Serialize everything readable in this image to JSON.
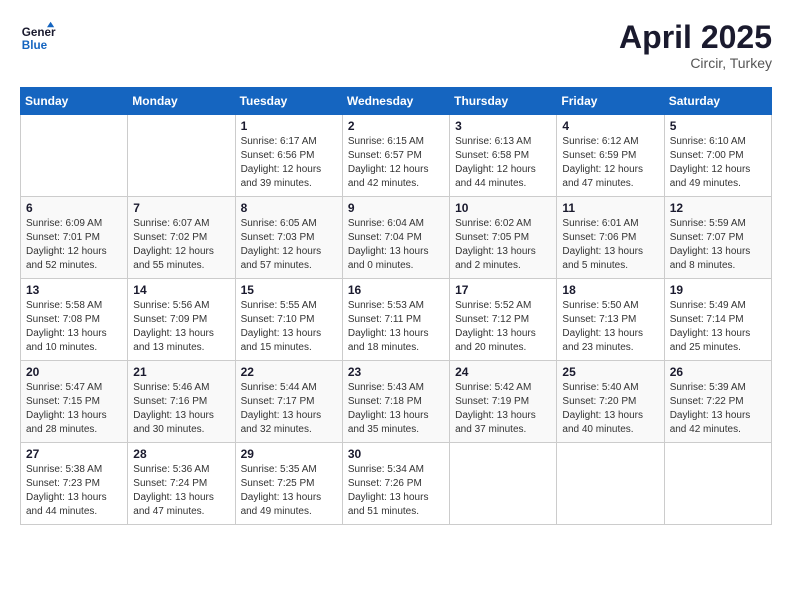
{
  "header": {
    "logo_line1": "General",
    "logo_line2": "Blue",
    "month_year": "April 2025",
    "location": "Circir, Turkey"
  },
  "weekdays": [
    "Sunday",
    "Monday",
    "Tuesday",
    "Wednesday",
    "Thursday",
    "Friday",
    "Saturday"
  ],
  "weeks": [
    [
      {
        "day": "",
        "detail": ""
      },
      {
        "day": "",
        "detail": ""
      },
      {
        "day": "1",
        "detail": "Sunrise: 6:17 AM\nSunset: 6:56 PM\nDaylight: 12 hours\nand 39 minutes."
      },
      {
        "day": "2",
        "detail": "Sunrise: 6:15 AM\nSunset: 6:57 PM\nDaylight: 12 hours\nand 42 minutes."
      },
      {
        "day": "3",
        "detail": "Sunrise: 6:13 AM\nSunset: 6:58 PM\nDaylight: 12 hours\nand 44 minutes."
      },
      {
        "day": "4",
        "detail": "Sunrise: 6:12 AM\nSunset: 6:59 PM\nDaylight: 12 hours\nand 47 minutes."
      },
      {
        "day": "5",
        "detail": "Sunrise: 6:10 AM\nSunset: 7:00 PM\nDaylight: 12 hours\nand 49 minutes."
      }
    ],
    [
      {
        "day": "6",
        "detail": "Sunrise: 6:09 AM\nSunset: 7:01 PM\nDaylight: 12 hours\nand 52 minutes."
      },
      {
        "day": "7",
        "detail": "Sunrise: 6:07 AM\nSunset: 7:02 PM\nDaylight: 12 hours\nand 55 minutes."
      },
      {
        "day": "8",
        "detail": "Sunrise: 6:05 AM\nSunset: 7:03 PM\nDaylight: 12 hours\nand 57 minutes."
      },
      {
        "day": "9",
        "detail": "Sunrise: 6:04 AM\nSunset: 7:04 PM\nDaylight: 13 hours\nand 0 minutes."
      },
      {
        "day": "10",
        "detail": "Sunrise: 6:02 AM\nSunset: 7:05 PM\nDaylight: 13 hours\nand 2 minutes."
      },
      {
        "day": "11",
        "detail": "Sunrise: 6:01 AM\nSunset: 7:06 PM\nDaylight: 13 hours\nand 5 minutes."
      },
      {
        "day": "12",
        "detail": "Sunrise: 5:59 AM\nSunset: 7:07 PM\nDaylight: 13 hours\nand 8 minutes."
      }
    ],
    [
      {
        "day": "13",
        "detail": "Sunrise: 5:58 AM\nSunset: 7:08 PM\nDaylight: 13 hours\nand 10 minutes."
      },
      {
        "day": "14",
        "detail": "Sunrise: 5:56 AM\nSunset: 7:09 PM\nDaylight: 13 hours\nand 13 minutes."
      },
      {
        "day": "15",
        "detail": "Sunrise: 5:55 AM\nSunset: 7:10 PM\nDaylight: 13 hours\nand 15 minutes."
      },
      {
        "day": "16",
        "detail": "Sunrise: 5:53 AM\nSunset: 7:11 PM\nDaylight: 13 hours\nand 18 minutes."
      },
      {
        "day": "17",
        "detail": "Sunrise: 5:52 AM\nSunset: 7:12 PM\nDaylight: 13 hours\nand 20 minutes."
      },
      {
        "day": "18",
        "detail": "Sunrise: 5:50 AM\nSunset: 7:13 PM\nDaylight: 13 hours\nand 23 minutes."
      },
      {
        "day": "19",
        "detail": "Sunrise: 5:49 AM\nSunset: 7:14 PM\nDaylight: 13 hours\nand 25 minutes."
      }
    ],
    [
      {
        "day": "20",
        "detail": "Sunrise: 5:47 AM\nSunset: 7:15 PM\nDaylight: 13 hours\nand 28 minutes."
      },
      {
        "day": "21",
        "detail": "Sunrise: 5:46 AM\nSunset: 7:16 PM\nDaylight: 13 hours\nand 30 minutes."
      },
      {
        "day": "22",
        "detail": "Sunrise: 5:44 AM\nSunset: 7:17 PM\nDaylight: 13 hours\nand 32 minutes."
      },
      {
        "day": "23",
        "detail": "Sunrise: 5:43 AM\nSunset: 7:18 PM\nDaylight: 13 hours\nand 35 minutes."
      },
      {
        "day": "24",
        "detail": "Sunrise: 5:42 AM\nSunset: 7:19 PM\nDaylight: 13 hours\nand 37 minutes."
      },
      {
        "day": "25",
        "detail": "Sunrise: 5:40 AM\nSunset: 7:20 PM\nDaylight: 13 hours\nand 40 minutes."
      },
      {
        "day": "26",
        "detail": "Sunrise: 5:39 AM\nSunset: 7:22 PM\nDaylight: 13 hours\nand 42 minutes."
      }
    ],
    [
      {
        "day": "27",
        "detail": "Sunrise: 5:38 AM\nSunset: 7:23 PM\nDaylight: 13 hours\nand 44 minutes."
      },
      {
        "day": "28",
        "detail": "Sunrise: 5:36 AM\nSunset: 7:24 PM\nDaylight: 13 hours\nand 47 minutes."
      },
      {
        "day": "29",
        "detail": "Sunrise: 5:35 AM\nSunset: 7:25 PM\nDaylight: 13 hours\nand 49 minutes."
      },
      {
        "day": "30",
        "detail": "Sunrise: 5:34 AM\nSunset: 7:26 PM\nDaylight: 13 hours\nand 51 minutes."
      },
      {
        "day": "",
        "detail": ""
      },
      {
        "day": "",
        "detail": ""
      },
      {
        "day": "",
        "detail": ""
      }
    ]
  ]
}
